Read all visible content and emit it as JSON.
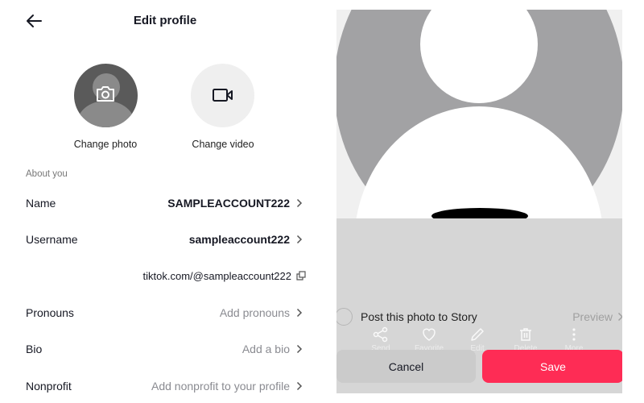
{
  "header": {
    "title": "Edit profile",
    "back_icon": "arrow-left-icon"
  },
  "avatars": {
    "photo_label": "Change photo",
    "photo_icon": "camera-icon",
    "video_label": "Change video",
    "video_icon": "video-camera-icon"
  },
  "about": {
    "section_label": "About you",
    "rows": [
      {
        "label": "Name",
        "value": "SAMPLEACCOUNT222",
        "placeholder": false
      },
      {
        "label": "Username",
        "value": "sampleaccount222",
        "placeholder": false
      },
      {
        "label": "Pronouns",
        "value": "Add pronouns",
        "placeholder": true
      },
      {
        "label": "Bio",
        "value": "Add a bio",
        "placeholder": true
      },
      {
        "label": "Nonprofit",
        "value": "Add nonprofit to your profile",
        "placeholder": true
      }
    ],
    "profile_link": "tiktok.com/@sampleaccount222",
    "copy_icon": "copy-icon"
  },
  "photo_dialog": {
    "story_option": "Post this photo to Story",
    "story_checked": false,
    "preview_label": "Preview",
    "actions": [
      {
        "label": "Send",
        "icon": "share-icon"
      },
      {
        "label": "Favorite",
        "icon": "heart-icon"
      },
      {
        "label": "Edit",
        "icon": "pencil-icon"
      },
      {
        "label": "Delete",
        "icon": "trash-icon"
      },
      {
        "label": "More",
        "icon": "more-vertical-icon"
      }
    ],
    "cancel_label": "Cancel",
    "save_label": "Save"
  },
  "colors": {
    "accent": "#fe2c55",
    "placeholder_text": "#8a8b91"
  }
}
